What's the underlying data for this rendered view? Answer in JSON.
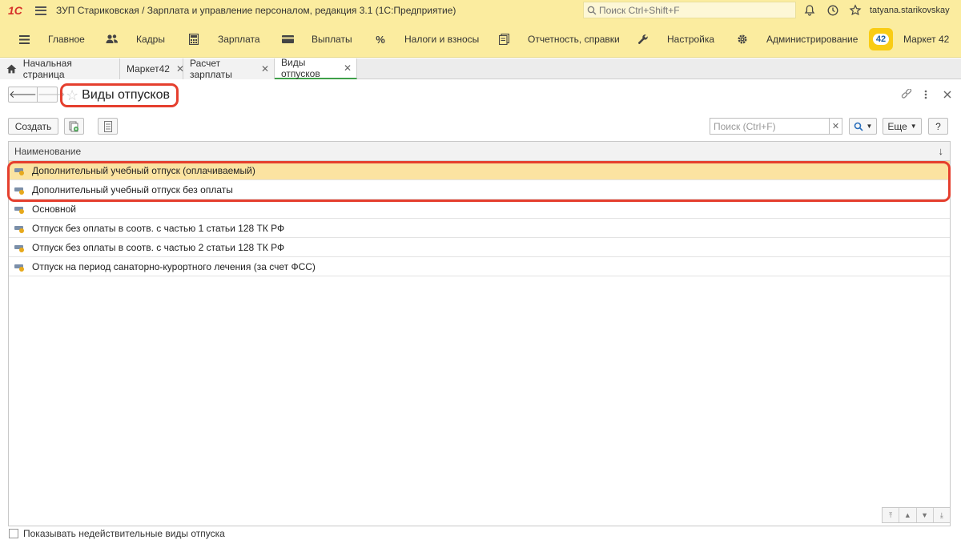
{
  "app": {
    "logo": "1С",
    "title": "ЗУП Стариковская / Зарплата и управление персоналом, редакция 3.1  (1С:Предприятие)",
    "search_placeholder": "Поиск Ctrl+Shift+F",
    "user": "tatyana.starikovskay"
  },
  "sections": [
    {
      "label": "Главное",
      "icon": "hamburger-icon"
    },
    {
      "label": "Кадры",
      "icon": "people-icon"
    },
    {
      "label": "Зарплата",
      "icon": "calculator-icon"
    },
    {
      "label": "Выплаты",
      "icon": "wallet-icon"
    },
    {
      "label": "Налоги и взносы",
      "icon": "percent-icon"
    },
    {
      "label": "Отчетность, справки",
      "icon": "documents-icon"
    },
    {
      "label": "Настройка",
      "icon": "wrench-icon"
    },
    {
      "label": "Администрирование",
      "icon": "gear-icon"
    }
  ],
  "market": {
    "badge": "42",
    "label": "Маркет 42"
  },
  "tabs": [
    {
      "label": "Начальная страница"
    },
    {
      "label": "Маркет42"
    },
    {
      "label": "Расчет зарплаты"
    },
    {
      "label": "Виды отпусков"
    }
  ],
  "form": {
    "title": "Виды отпусков",
    "create_label": "Создать",
    "search_placeholder": "Поиск (Ctrl+F)",
    "more_label": "Еще",
    "help_label": "?"
  },
  "table": {
    "column": "Наименование",
    "rows": [
      {
        "name": "Дополнительный учебный отпуск (оплачиваемый)"
      },
      {
        "name": "Дополнительный учебный отпуск без оплаты"
      },
      {
        "name": "Основной"
      },
      {
        "name": "Отпуск без оплаты в соотв. с частью 1 статьи 128 ТК РФ"
      },
      {
        "name": "Отпуск без оплаты в соотв. с частью 2 статьи 128 ТК РФ"
      },
      {
        "name": "Отпуск на период санаторно-курортного лечения (за счет ФСС)"
      }
    ],
    "selected_index": 0
  },
  "show_invalid_label": "Показывать недействительные виды отпуска",
  "colors": {
    "header_bg": "#fbec9f",
    "selected_row": "#fbe3a1",
    "highlight": "#e53f2e",
    "active_tab": "#3fa04a"
  }
}
